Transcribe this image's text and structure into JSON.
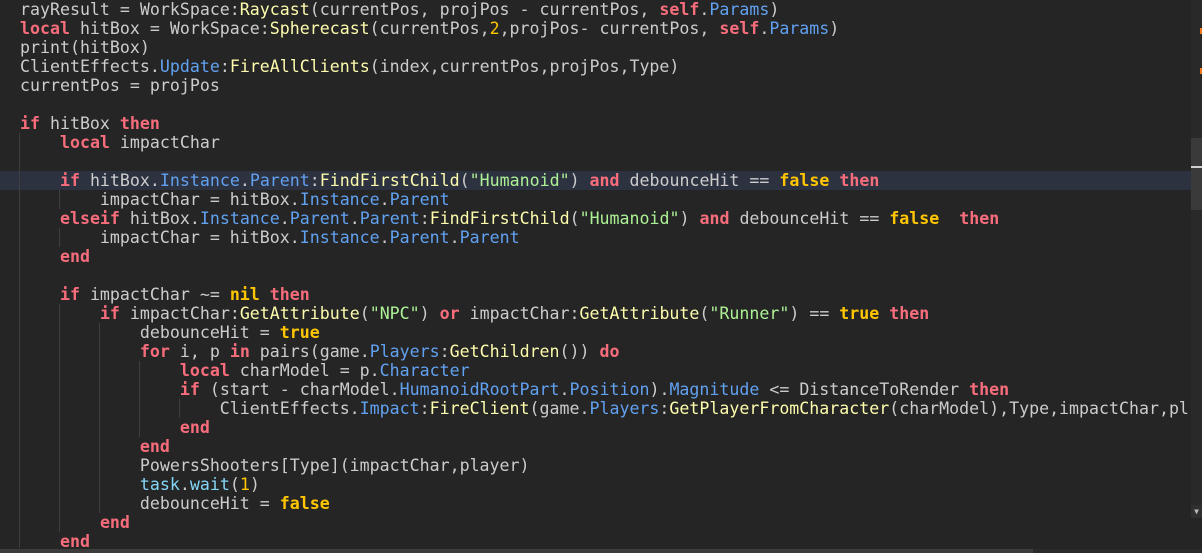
{
  "colors": {
    "background": "#252525",
    "keyword": "#f86d7c",
    "literal": "#ffc600",
    "property": "#61a1f1",
    "method": "#fdfbac",
    "string": "#adf195",
    "text": "#cccccc",
    "current_line": "#2d3240",
    "change_marker": "#f7781d"
  },
  "current_line_index": 9,
  "scrollbar": {
    "down_icon": "triangle-down-icon",
    "down_glyph": "▼"
  },
  "lines": [
    {
      "tokens": [
        {
          "c": "t",
          "v": "rayResult = WorkSpace:"
        },
        {
          "c": "m",
          "v": "Raycast"
        },
        {
          "c": "t",
          "v": "(currentPos, projPos - currentPos, "
        },
        {
          "c": "k",
          "v": "self"
        },
        {
          "c": "t",
          "v": "."
        },
        {
          "c": "p",
          "v": "Params"
        },
        {
          "c": "t",
          "v": ")"
        }
      ]
    },
    {
      "tokens": [
        {
          "c": "k",
          "v": "local"
        },
        {
          "c": "t",
          "v": " hitBox = WorkSpace:"
        },
        {
          "c": "m",
          "v": "Spherecast"
        },
        {
          "c": "t",
          "v": "(currentPos,"
        },
        {
          "c": "n",
          "v": "2"
        },
        {
          "c": "t",
          "v": ",projPos- currentPos, "
        },
        {
          "c": "k",
          "v": "self"
        },
        {
          "c": "t",
          "v": "."
        },
        {
          "c": "p",
          "v": "Params"
        },
        {
          "c": "t",
          "v": ")"
        }
      ]
    },
    {
      "tokens": [
        {
          "c": "t",
          "v": "print(hitBox)"
        }
      ]
    },
    {
      "tokens": [
        {
          "c": "t",
          "v": "ClientEffects."
        },
        {
          "c": "p",
          "v": "Update"
        },
        {
          "c": "t",
          "v": ":"
        },
        {
          "c": "m",
          "v": "FireAllClients"
        },
        {
          "c": "t",
          "v": "(index,currentPos,projPos,Type)"
        }
      ]
    },
    {
      "tokens": [
        {
          "c": "t",
          "v": "currentPos = projPos"
        }
      ]
    },
    {
      "tokens": []
    },
    {
      "tokens": [
        {
          "c": "k",
          "v": "if"
        },
        {
          "c": "t",
          "v": " hitBox "
        },
        {
          "c": "k",
          "v": "then"
        }
      ]
    },
    {
      "tokens": [
        {
          "c": "t",
          "v": "    "
        },
        {
          "c": "k",
          "v": "local"
        },
        {
          "c": "t",
          "v": " impactChar"
        }
      ]
    },
    {
      "tokens": [
        {
          "c": "t",
          "v": "    "
        }
      ]
    },
    {
      "tokens": [
        {
          "c": "t",
          "v": "    "
        },
        {
          "c": "k",
          "v": "if"
        },
        {
          "c": "t",
          "v": " hitBox."
        },
        {
          "c": "p",
          "v": "Instance"
        },
        {
          "c": "t",
          "v": "."
        },
        {
          "c": "p",
          "v": "Parent"
        },
        {
          "c": "t",
          "v": ":"
        },
        {
          "c": "m",
          "v": "FindFirstChild"
        },
        {
          "c": "t",
          "v": "("
        },
        {
          "c": "s",
          "v": "\"Humanoid\""
        },
        {
          "c": "t",
          "v": ") "
        },
        {
          "c": "k",
          "v": "and"
        },
        {
          "c": "t",
          "v": " debounceHit == "
        },
        {
          "c": "b",
          "v": "false"
        },
        {
          "c": "t",
          "v": " "
        },
        {
          "c": "k",
          "v": "then"
        }
      ]
    },
    {
      "tokens": [
        {
          "c": "t",
          "v": "        impactChar = hitBox."
        },
        {
          "c": "p",
          "v": "Instance"
        },
        {
          "c": "t",
          "v": "."
        },
        {
          "c": "p",
          "v": "Parent"
        }
      ]
    },
    {
      "tokens": [
        {
          "c": "t",
          "v": "    "
        },
        {
          "c": "k",
          "v": "elseif"
        },
        {
          "c": "t",
          "v": " hitBox."
        },
        {
          "c": "p",
          "v": "Instance"
        },
        {
          "c": "t",
          "v": "."
        },
        {
          "c": "p",
          "v": "Parent"
        },
        {
          "c": "t",
          "v": "."
        },
        {
          "c": "p",
          "v": "Parent"
        },
        {
          "c": "t",
          "v": ":"
        },
        {
          "c": "m",
          "v": "FindFirstChild"
        },
        {
          "c": "t",
          "v": "("
        },
        {
          "c": "s",
          "v": "\"Humanoid\""
        },
        {
          "c": "t",
          "v": ") "
        },
        {
          "c": "k",
          "v": "and"
        },
        {
          "c": "t",
          "v": " debounceHit == "
        },
        {
          "c": "b",
          "v": "false"
        },
        {
          "c": "t",
          "v": "  "
        },
        {
          "c": "k",
          "v": "then"
        }
      ]
    },
    {
      "tokens": [
        {
          "c": "t",
          "v": "        impactChar = hitBox."
        },
        {
          "c": "p",
          "v": "Instance"
        },
        {
          "c": "t",
          "v": "."
        },
        {
          "c": "p",
          "v": "Parent"
        },
        {
          "c": "t",
          "v": "."
        },
        {
          "c": "p",
          "v": "Parent"
        }
      ]
    },
    {
      "tokens": [
        {
          "c": "t",
          "v": "    "
        },
        {
          "c": "k",
          "v": "end"
        }
      ]
    },
    {
      "tokens": [
        {
          "c": "t",
          "v": "    "
        }
      ]
    },
    {
      "tokens": [
        {
          "c": "t",
          "v": "    "
        },
        {
          "c": "k",
          "v": "if"
        },
        {
          "c": "t",
          "v": " impactChar ~= "
        },
        {
          "c": "b",
          "v": "nil"
        },
        {
          "c": "t",
          "v": " "
        },
        {
          "c": "k",
          "v": "then"
        }
      ]
    },
    {
      "tokens": [
        {
          "c": "t",
          "v": "        "
        },
        {
          "c": "k",
          "v": "if"
        },
        {
          "c": "t",
          "v": " impactChar:"
        },
        {
          "c": "m",
          "v": "GetAttribute"
        },
        {
          "c": "t",
          "v": "("
        },
        {
          "c": "s",
          "v": "\"NPC\""
        },
        {
          "c": "t",
          "v": ") "
        },
        {
          "c": "k",
          "v": "or"
        },
        {
          "c": "t",
          "v": " impactChar:"
        },
        {
          "c": "m",
          "v": "GetAttribute"
        },
        {
          "c": "t",
          "v": "("
        },
        {
          "c": "s",
          "v": "\"Runner\""
        },
        {
          "c": "t",
          "v": ") == "
        },
        {
          "c": "b",
          "v": "true"
        },
        {
          "c": "t",
          "v": " "
        },
        {
          "c": "k",
          "v": "then"
        }
      ]
    },
    {
      "tokens": [
        {
          "c": "t",
          "v": "            debounceHit = "
        },
        {
          "c": "b",
          "v": "true"
        }
      ]
    },
    {
      "tokens": [
        {
          "c": "t",
          "v": "            "
        },
        {
          "c": "k",
          "v": "for"
        },
        {
          "c": "t",
          "v": " i, p "
        },
        {
          "c": "k",
          "v": "in"
        },
        {
          "c": "t",
          "v": " pairs(game."
        },
        {
          "c": "p",
          "v": "Players"
        },
        {
          "c": "t",
          "v": ":"
        },
        {
          "c": "m",
          "v": "GetChildren"
        },
        {
          "c": "t",
          "v": "()) "
        },
        {
          "c": "k",
          "v": "do"
        }
      ]
    },
    {
      "tokens": [
        {
          "c": "t",
          "v": "                "
        },
        {
          "c": "k",
          "v": "local"
        },
        {
          "c": "t",
          "v": " charModel = p."
        },
        {
          "c": "p",
          "v": "Character"
        }
      ]
    },
    {
      "tokens": [
        {
          "c": "t",
          "v": "                "
        },
        {
          "c": "k",
          "v": "if"
        },
        {
          "c": "t",
          "v": " (start - charModel."
        },
        {
          "c": "p",
          "v": "HumanoidRootPart"
        },
        {
          "c": "t",
          "v": "."
        },
        {
          "c": "p",
          "v": "Position"
        },
        {
          "c": "t",
          "v": ")."
        },
        {
          "c": "p",
          "v": "Magnitude"
        },
        {
          "c": "t",
          "v": " <= DistanceToRender "
        },
        {
          "c": "k",
          "v": "then"
        }
      ]
    },
    {
      "tokens": [
        {
          "c": "t",
          "v": "                    ClientEffects."
        },
        {
          "c": "p",
          "v": "Impact"
        },
        {
          "c": "t",
          "v": ":"
        },
        {
          "c": "m",
          "v": "FireClient"
        },
        {
          "c": "t",
          "v": "(game."
        },
        {
          "c": "p",
          "v": "Players"
        },
        {
          "c": "t",
          "v": ":"
        },
        {
          "c": "m",
          "v": "GetPlayerFromCharacter"
        },
        {
          "c": "t",
          "v": "(charModel),Type,impactChar,pl"
        }
      ]
    },
    {
      "tokens": [
        {
          "c": "t",
          "v": "                "
        },
        {
          "c": "k",
          "v": "end"
        }
      ]
    },
    {
      "tokens": [
        {
          "c": "t",
          "v": "            "
        },
        {
          "c": "k",
          "v": "end"
        }
      ]
    },
    {
      "tokens": [
        {
          "c": "t",
          "v": "            PowersShooters[Type](impactChar,player)"
        }
      ]
    },
    {
      "tokens": [
        {
          "c": "t",
          "v": "            "
        },
        {
          "c": "bi",
          "v": "task"
        },
        {
          "c": "t",
          "v": "."
        },
        {
          "c": "bi",
          "v": "wait"
        },
        {
          "c": "t",
          "v": "("
        },
        {
          "c": "n",
          "v": "1"
        },
        {
          "c": "t",
          "v": ")"
        }
      ]
    },
    {
      "tokens": [
        {
          "c": "t",
          "v": "            debounceHit = "
        },
        {
          "c": "b",
          "v": "false"
        }
      ]
    },
    {
      "tokens": [
        {
          "c": "t",
          "v": "        "
        },
        {
          "c": "k",
          "v": "end"
        }
      ]
    },
    {
      "tokens": [
        {
          "c": "t",
          "v": "    "
        },
        {
          "c": "k",
          "v": "end"
        }
      ]
    }
  ]
}
